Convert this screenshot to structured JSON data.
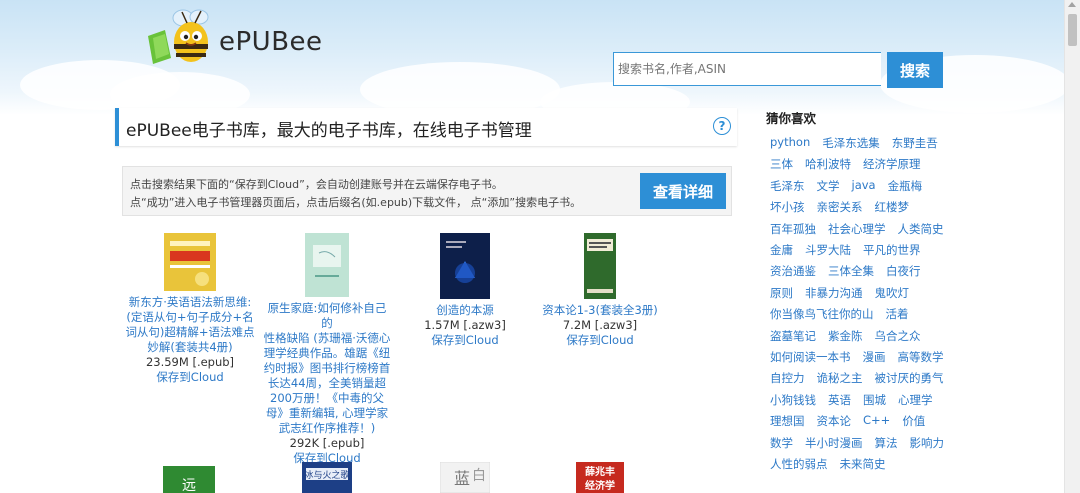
{
  "site": {
    "logo_text": "ePUBee",
    "headline": "ePUBee电子书库，最大的电子书库，在线电子书管理",
    "help_glyph": "?"
  },
  "search": {
    "placeholder": "搜索书名,作者,ASIN",
    "button_label": "搜索"
  },
  "info": {
    "line1": "点击搜索结果下面的“保存到Cloud”，会自动创建账号并在云端保存电子书。",
    "line2": "点“成功”进入电子书管理器页面后，点击后缀名(如.epub)下载文件， 点“添加”搜索电子书。",
    "button_label": "查看详细"
  },
  "books": [
    {
      "title_lines": [
        "新东方·英语语法新思维:",
        "(定语从句+句子成分+名",
        "词从句)超精解+语法难点",
        "妙解(套装共4册)"
      ],
      "size": "23.59M [.epub]",
      "save": "保存到Cloud",
      "cover_color": "#e9c43a"
    },
    {
      "title_lines": [
        "原生家庭:如何修补自己的",
        "性格缺陷 (苏珊福·沃德心",
        "理学经典作品。雄踞《纽",
        "约时报》图书排行榜榜首",
        "长达44周，全美销量超",
        "200万册！《中毒的父",
        "母》重新编辑, 心理学家",
        "武志红作序推荐！)"
      ],
      "size": "292K [.epub]",
      "save": "保存到Cloud",
      "cover_color": "#bfe3d4"
    },
    {
      "title_lines": [
        "创造的本源"
      ],
      "size": "1.57M [.azw3]",
      "save": "保存到Cloud",
      "cover_color": "#0d1f4a"
    },
    {
      "title_lines": [
        "资本论1-3(套装全3册)"
      ],
      "size": "7.2M [.azw3]",
      "save": "保存到Cloud",
      "cover_color": "#2f6a2c"
    }
  ],
  "sidebar": {
    "title": "猜你喜欢",
    "rows": [
      [
        "python",
        "毛泽东选集",
        "东野圭吾"
      ],
      [
        "三体",
        "哈利波特",
        "经济学原理"
      ],
      [
        "毛泽东",
        "文学",
        "java",
        "金瓶梅"
      ],
      [
        "坏小孩",
        "亲密关系",
        "红楼梦"
      ],
      [
        "百年孤独",
        "社会心理学",
        "人类简史"
      ],
      [
        "金庸",
        "斗罗大陆",
        "平凡的世界"
      ],
      [
        "资治通鉴",
        "三体全集",
        "白夜行"
      ],
      [
        "原则",
        "非暴力沟通",
        "鬼吹灯"
      ],
      [
        "你当像鸟飞往你的山",
        "活着"
      ],
      [
        "盗墓笔记",
        "紫金陈",
        "乌合之众"
      ],
      [
        "如何阅读一本书",
        "漫画",
        "高等数学"
      ],
      [
        "自控力",
        "诡秘之主",
        "被讨厌的勇气"
      ],
      [
        "小狗钱钱",
        "英语",
        "围城",
        "心理学"
      ],
      [
        "理想国",
        "资本论",
        "C++",
        "价值"
      ],
      [
        "数学",
        "半小时漫画",
        "算法",
        "影响力"
      ],
      [
        "人性的弱点",
        "未来简史"
      ]
    ]
  }
}
